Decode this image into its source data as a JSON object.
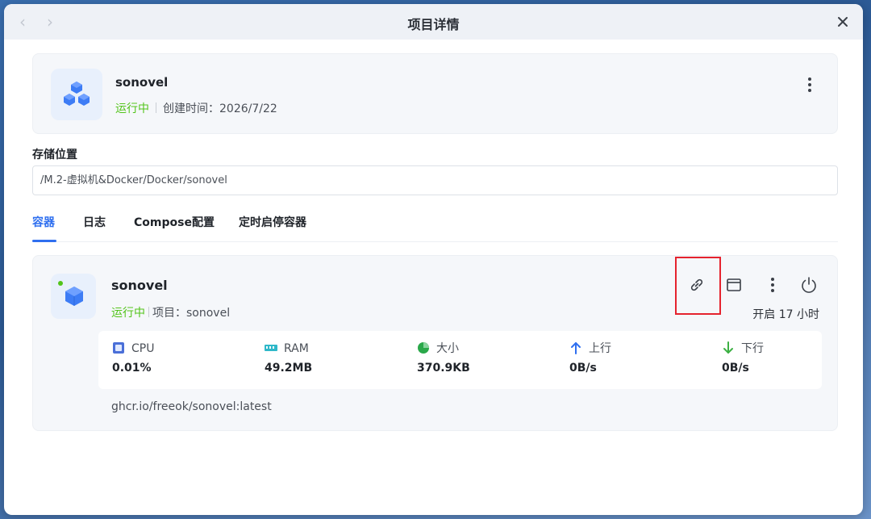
{
  "window": {
    "title": "项目详情"
  },
  "project": {
    "name": "sonovel",
    "status": "运行中",
    "created_label": "创建时间：",
    "created_value": "2026/7/22"
  },
  "storage": {
    "label": "存储位置",
    "path": "/M.2-虚拟机&Docker/Docker/sonovel"
  },
  "tabs": [
    {
      "label": "容器",
      "active": true
    },
    {
      "label": "日志",
      "active": false
    },
    {
      "label": "Compose配置",
      "active": false
    },
    {
      "label": "定时启停容器",
      "active": false
    }
  ],
  "container": {
    "name": "sonovel",
    "status": "运行中",
    "project_label": "项目：",
    "project_value": "sonovel",
    "uptime": "开启 17 小时",
    "image": "ghcr.io/freeok/sonovel:latest",
    "stats": [
      {
        "label": "CPU",
        "value": "0.01%",
        "icon": "cpu-icon"
      },
      {
        "label": "RAM",
        "value": "49.2MB",
        "icon": "ram-icon"
      },
      {
        "label": "大小",
        "value": "370.9KB",
        "icon": "pie-icon"
      },
      {
        "label": "上行",
        "value": "0B/s",
        "icon": "arrow-up-icon"
      },
      {
        "label": "下行",
        "value": "0B/s",
        "icon": "arrow-down-icon"
      }
    ]
  },
  "colors": {
    "accent": "#2f6fef",
    "running": "#52c41a",
    "highlight": "#e5232e"
  }
}
